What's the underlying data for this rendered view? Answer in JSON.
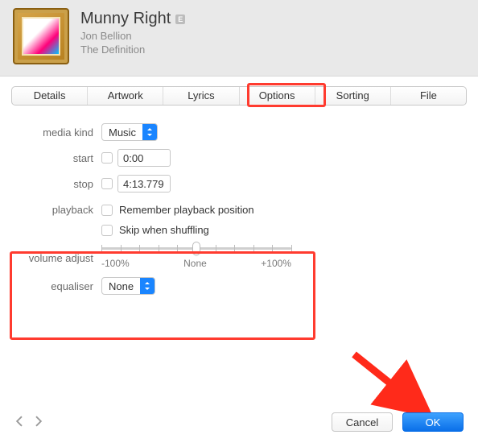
{
  "header": {
    "title": "Munny Right",
    "badge": "E",
    "artist": "Jon Bellion",
    "album": "The Definition"
  },
  "tabs": [
    "Details",
    "Artwork",
    "Lyrics",
    "Options",
    "Sorting",
    "File"
  ],
  "active_tab": "Options",
  "form": {
    "media_kind": {
      "label": "media kind",
      "value": "Music"
    },
    "start": {
      "label": "start",
      "checked": false,
      "value": "0:00"
    },
    "stop": {
      "label": "stop",
      "checked": false,
      "value": "4:13.779"
    },
    "playback": {
      "label": "playback",
      "remember": "Remember playback position",
      "remember_checked": false,
      "skip": "Skip when shuffling",
      "skip_checked": false
    },
    "volume": {
      "label": "volume adjust",
      "min": "-100%",
      "mid": "None",
      "max": "+100%",
      "value": 0
    },
    "equaliser": {
      "label": "equaliser",
      "value": "None"
    }
  },
  "footer": {
    "cancel": "Cancel",
    "ok": "OK"
  },
  "annotations": {
    "highlight_color": "#ff3b2f",
    "arrow_color": "#ff2a1a"
  }
}
